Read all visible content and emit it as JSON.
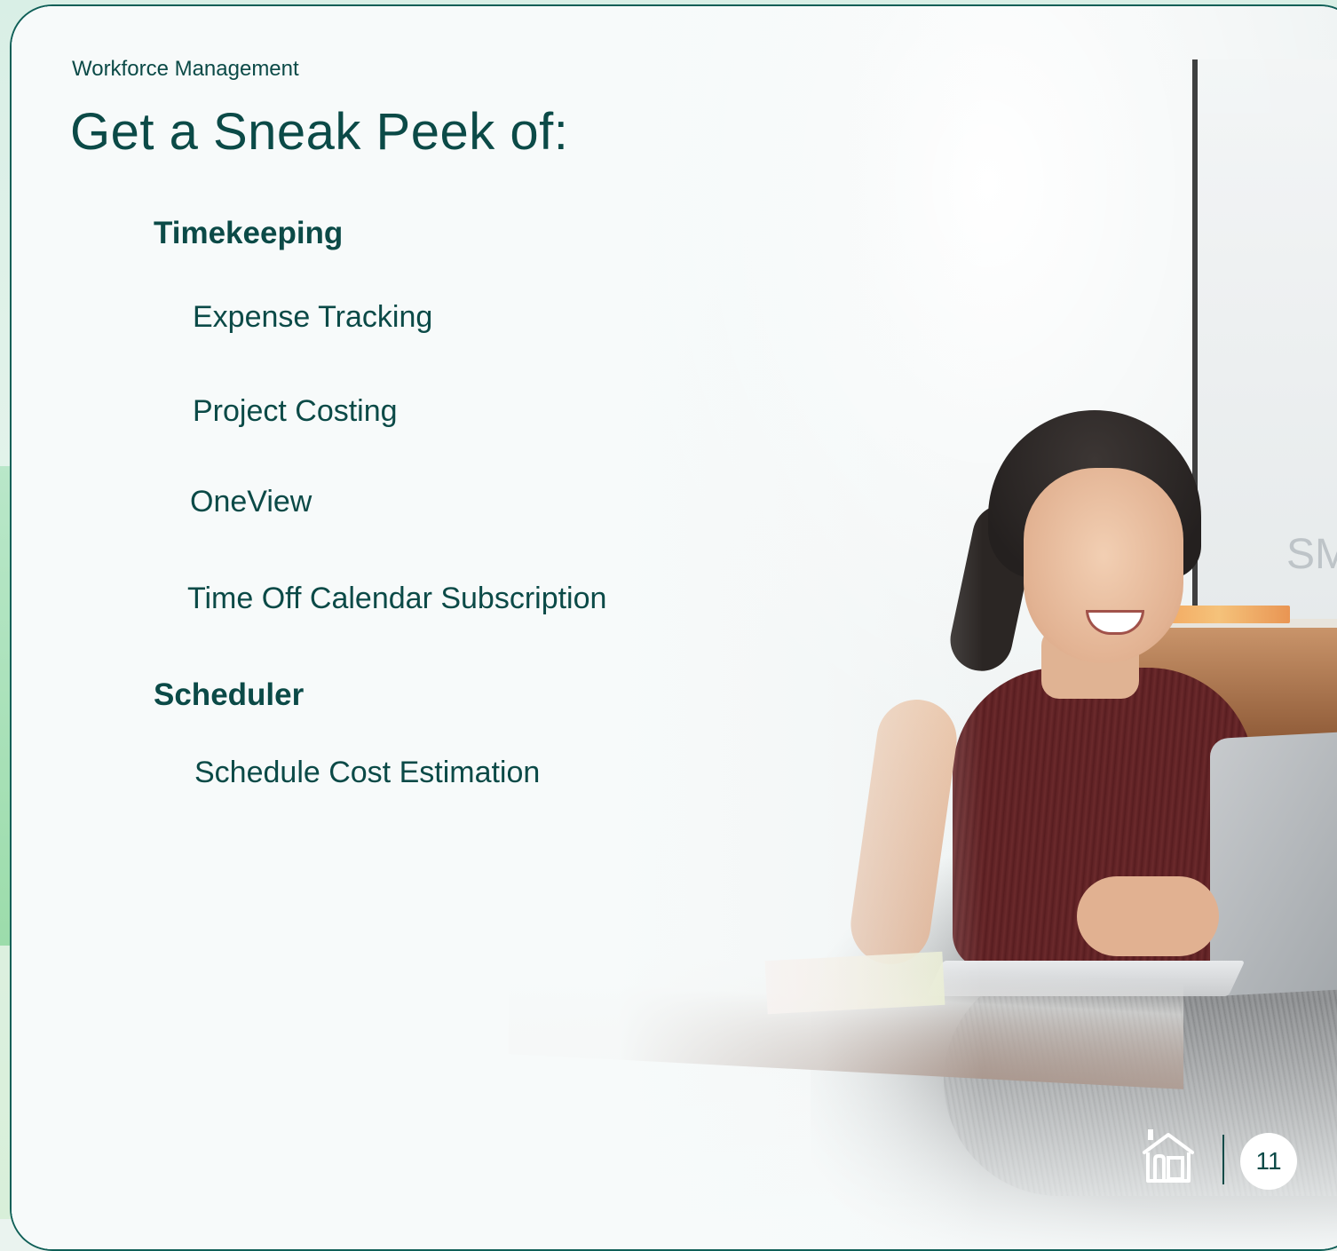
{
  "slide": {
    "kicker": "Workforce Management",
    "title": "Get a Sneak Peek of:",
    "sections": [
      {
        "heading": "Timekeeping",
        "items": [
          "Expense Tracking",
          "Project Costing",
          "OneView",
          "Time Off Calendar Subscription"
        ]
      },
      {
        "heading": "Scheduler",
        "items": [
          "Schedule Cost Estimation"
        ]
      }
    ]
  },
  "footer": {
    "home_icon": "home-icon",
    "page_number": "11"
  },
  "colors": {
    "text": "#0b4a47",
    "border": "#0f5f57",
    "background": "#f7fafa"
  },
  "photo": {
    "background_text": "SM"
  }
}
